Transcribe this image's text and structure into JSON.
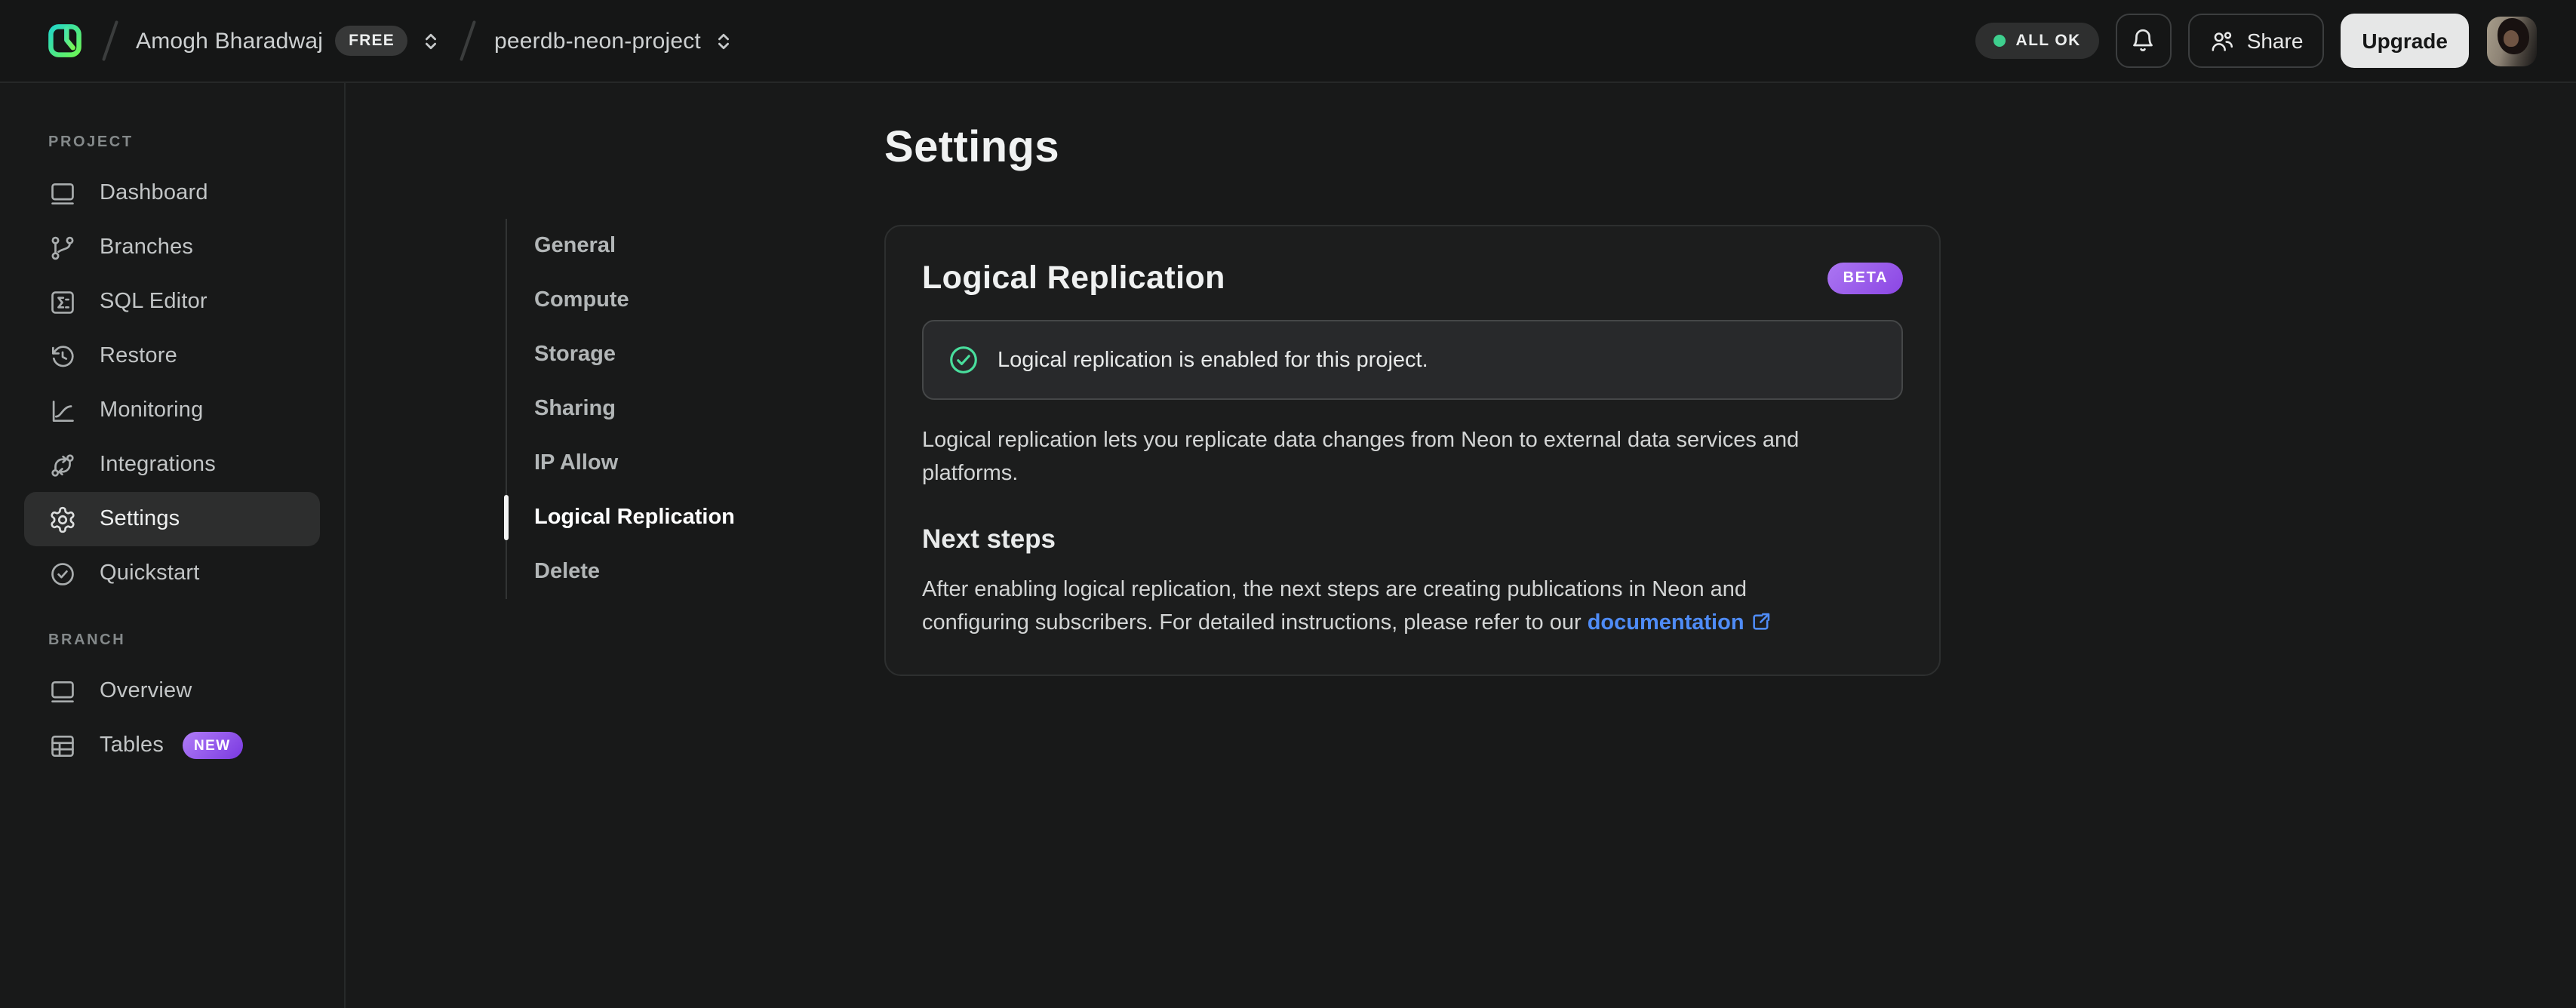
{
  "header": {
    "breadcrumb": {
      "org_name": "Amogh Bharadwaj",
      "org_badge": "FREE",
      "project_name": "peerdb-neon-project"
    },
    "status_badge": "ALL OK",
    "share_label": "Share",
    "upgrade_label": "Upgrade"
  },
  "sidebar": {
    "sections": [
      {
        "label": "PROJECT",
        "items": [
          {
            "label": "Dashboard"
          },
          {
            "label": "Branches"
          },
          {
            "label": "SQL Editor"
          },
          {
            "label": "Restore"
          },
          {
            "label": "Monitoring"
          },
          {
            "label": "Integrations"
          },
          {
            "label": "Settings"
          },
          {
            "label": "Quickstart"
          }
        ]
      },
      {
        "label": "BRANCH",
        "items": [
          {
            "label": "Overview"
          },
          {
            "label": "Tables",
            "badge": "NEW"
          }
        ]
      }
    ]
  },
  "settings_nav": {
    "items": [
      {
        "label": "General"
      },
      {
        "label": "Compute"
      },
      {
        "label": "Storage"
      },
      {
        "label": "Sharing"
      },
      {
        "label": "IP Allow"
      },
      {
        "label": "Logical Replication"
      },
      {
        "label": "Delete"
      }
    ],
    "active": "Logical Replication"
  },
  "main": {
    "title": "Settings",
    "card": {
      "title": "Logical Replication",
      "badge": "BETA",
      "alert_text": "Logical replication is enabled for this project.",
      "description": "Logical replication lets you replicate data changes from Neon to external data services and platforms.",
      "subheading": "Next steps",
      "next_steps_text": "After enabling logical replication, the next steps are creating publications in Neon and configuring subscribers. For detailed instructions, please refer to our ",
      "link_label": "documentation"
    }
  },
  "colors": {
    "accent_green": "#3ecf8e",
    "link_blue": "#4f8cf7",
    "badge_purple": "#8b46e4",
    "logo_teal": "#23d6c6",
    "logo_green": "#6df655"
  }
}
